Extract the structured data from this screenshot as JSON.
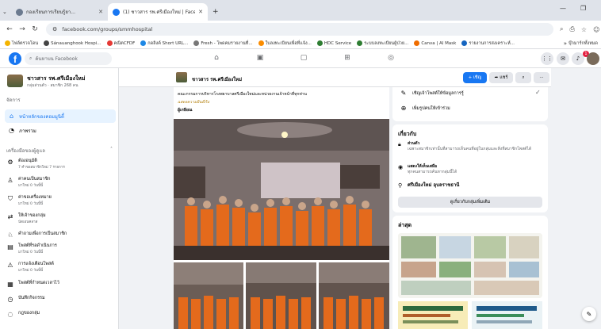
{
  "browser": {
    "tabs": [
      {
        "title": "กองเรียนการเรียนรู้ยา...",
        "active": false,
        "icon": "globe-icon"
      },
      {
        "title": "(1) ชาวสาร รพ.ศรีเมืองใหม่ | Faceb...",
        "active": true,
        "icon": "facebook-icon"
      }
    ],
    "new_tab": "+",
    "url": "facebook.com/groups/smmhospital",
    "bookmarks": [
      "ไฟล์ตรวจโดน",
      "Sánauanghook Hospi...",
      "คณิตCFDF",
      "กดลิงค์ Short URL...",
      "Fresh - โพดคมรายงานที่...",
      "ใบลงทะเบียนเพื่อที่แจ้ง...",
      "HDC Service",
      "ระบบลงทะเบียนผู้ป่วย...",
      "Canva | AI Mask",
      "รายงานการสงเคราะห์..."
    ],
    "all_bookmarks": "บุ๊กมาร์กทั้งหมด"
  },
  "fb": {
    "search_placeholder": "ค้นหาบน Facebook",
    "notification_count": "1"
  },
  "sidebar": {
    "group_name": "ชาวสาร รพ.ศรีเมืองใหม่",
    "group_meta": "กลุ่มส่วนตัว · สมาชิก 268 คน",
    "manage_label": "จัดการ",
    "nav": [
      {
        "label": "หน้าหลักของคอมมูนิตี้",
        "icon": "home-icon",
        "selected": true
      },
      {
        "label": "ภาพรวม",
        "icon": "overview-icon",
        "selected": false
      }
    ],
    "tools_header": "เครื่องมือของผู้ดูแล",
    "tools": [
      {
        "title": "ต้องอนุมัติ",
        "sub": "7 คำขอสมาชิกใหม่ 7 รายการ",
        "icon": "approve-icon"
      },
      {
        "title": "ค่าคนเป็นสมาชิก",
        "sub": "มาใหม่ 0 วันนี้นี้",
        "icon": "members-icon"
      },
      {
        "title": "ค่าขอเครื่องหมาย",
        "sub": "มาใหม่ 0 วันนี้นี้",
        "icon": "badge-icon"
      },
      {
        "title": "ให้เจ้าของกลุ่ม",
        "sub": "นัดเอนคลาส",
        "icon": "owner-icon"
      },
      {
        "title": "คำถามเพื่อการเป็นสมาชิก",
        "sub": "",
        "icon": "question-icon"
      },
      {
        "title": "โพสต์ที่รอดำเนินการ",
        "sub": "มาใหม่ 0 วันนี้นี้",
        "icon": "pending-icon"
      },
      {
        "title": "การแจ้งเตือนโพสต์",
        "sub": "มาใหม่ 0 วันนี้นี้",
        "icon": "alert-icon"
      },
      {
        "title": "โพสต์ที่กำหนดเวลาไว้",
        "sub": "",
        "icon": "schedule-icon"
      },
      {
        "title": "บันทึกกิจกรรม",
        "sub": "",
        "icon": "log-icon"
      },
      {
        "title": "กฎของกลุ่ม",
        "sub": "",
        "icon": "rules-icon"
      }
    ]
  },
  "groupbar": {
    "name": "ชาวสาร รพ.ศรีเมืองใหม่",
    "invite_label": "+ เชิญ",
    "share_label": "แชร์"
  },
  "post": {
    "line1": "คณะกรรมการบริหารโรงพยาบาลศรีเมืองใหม่และหน่วยงานเจ้าหน้าที่ทุกท่าน",
    "line2": "แสดงความยินดีกับ",
    "line3": "ผู้เกษียณ"
  },
  "right": {
    "invite_row": "เชิญเจ้าโพสต์ให้ข้อมูลการรู้",
    "sponsor_row": "เพิ่มรูปคนให้เข้าร่วม",
    "about_title": "เกี่ยวกับ",
    "about_private_title": "ส่วนตัว",
    "about_private_text": "เฉพาะสมาชิกเท่านั้นที่สามารถเห็นคนที่อยู่ในกลุ่มและสิ่งที่สมาชิกโพสต์ได้",
    "about_visible_title": "แสดงให้เห็นเสมือ",
    "about_visible_text": "ทุกคนสามารถค้นหากลุ่มนี้ได้",
    "about_location": "ศรีเมืองใหม่ อุบลราชธานี",
    "about_button": "ดูเกี่ยวกับกลุ่มเพิ่มเติม",
    "recent_title": "ล่าสุด"
  },
  "colors": {
    "fb_blue": "#1877f2",
    "sidebar_selected_bg": "#e7f3ff",
    "page_bg": "#f0f2f5"
  }
}
